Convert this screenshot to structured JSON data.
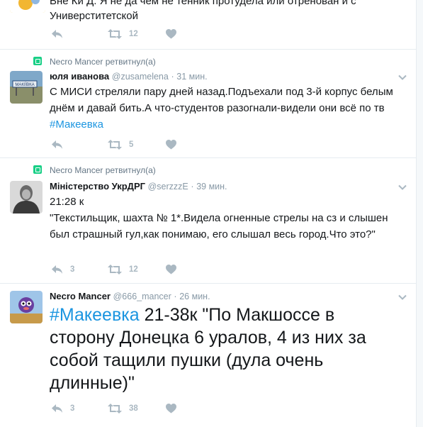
{
  "tweets": [
    {
      "text_partial": "Универститетской",
      "text_top_partial": "Вне Ки Д. Я не да чем не тенник протудела или отренован и с",
      "actions": {
        "reply": "",
        "retweet": "12",
        "like": ""
      }
    },
    {
      "retweeted_by": "Necro Mancer ретвитнул(а)",
      "name": "юля иванова",
      "handle": "@zusamelena",
      "time": "31 мин.",
      "text_before": "С МИСИ стреляли пару дней назад.Подъехали под 3-й корпус белым днём и давай бить.А что-студентов разогнали-видели они всё по тв ",
      "hashtag": "#Макеевка",
      "avatar_sign": "МАКІЇВКА",
      "actions": {
        "reply": "",
        "retweet": "5",
        "like": ""
      }
    },
    {
      "retweeted_by": "Necro Mancer ретвитнул(а)",
      "name": "Міністерство УкрДРГ",
      "handle": "@serzzzE",
      "time": "39 мин.",
      "text_lines": [
        "21:28 к",
        "\"Текстильщик, шахта № 1*.Видела огненные стрелы на сз и слышен был страшный гул,как понимаю, его слышал весь город.Что это?\""
      ],
      "actions": {
        "reply": "3",
        "retweet": "12",
        "like": ""
      }
    },
    {
      "name": "Necro Mancer",
      "handle": "@666_mancer",
      "time": "26 мин.",
      "hashtag": "#Макеевка",
      "text_after": " 21-38к \"По Макшоссе в сторону Донецка 6 уралов, 4 из них за собой тащили пушки (дула очень длинные)\"",
      "actions": {
        "reply": "3",
        "retweet": "38",
        "like": ""
      }
    }
  ],
  "colors": {
    "hashtag": "#1b95e0",
    "retweet_badge": "#19cf86",
    "action_icon": "#aab8c2",
    "meta_text": "#8899a6",
    "divider": "#e6ecf0"
  },
  "icons": {
    "reply": "reply-icon",
    "retweet": "retweet-icon",
    "like": "heart-icon",
    "caret": "chevron-down-icon"
  }
}
